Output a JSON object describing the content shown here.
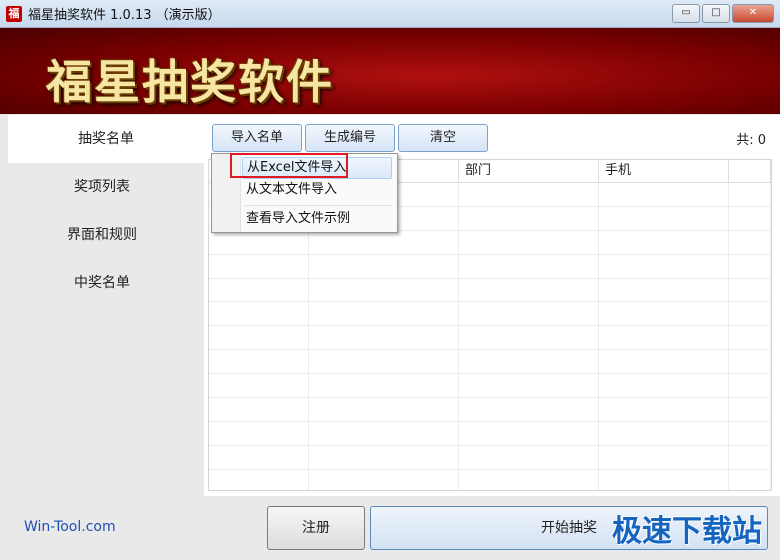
{
  "window": {
    "icon_char": "福",
    "title": "福星抽奖软件 1.0.13 （演示版）",
    "min_glyph": "▭",
    "max_glyph": "□",
    "close_glyph": "✕"
  },
  "banner": {
    "title": "福星抽奖软件"
  },
  "sidebar": {
    "items": [
      {
        "label": "抽奖名单",
        "active": true
      },
      {
        "label": "奖项列表"
      },
      {
        "label": "界面和规则"
      },
      {
        "label": "中奖名单"
      }
    ]
  },
  "toolbar": {
    "import_label": "导入名单",
    "generate_label": "生成编号",
    "clear_label": "清空",
    "count_text": "共: 0"
  },
  "table": {
    "columns": [
      "",
      "",
      "部门",
      "手机",
      ""
    ]
  },
  "menu": {
    "items": [
      "从Excel文件导入",
      "从文本文件导入",
      "查看导入文件示例"
    ]
  },
  "footer": {
    "site": "Win-Tool.com",
    "register_label": "注册",
    "start_label": "开始抽奖",
    "watermark": "极速下载站"
  },
  "colors": {
    "accent": "#7da2ce",
    "banner": "#8b0000",
    "highlight_box": "#e11b22"
  }
}
